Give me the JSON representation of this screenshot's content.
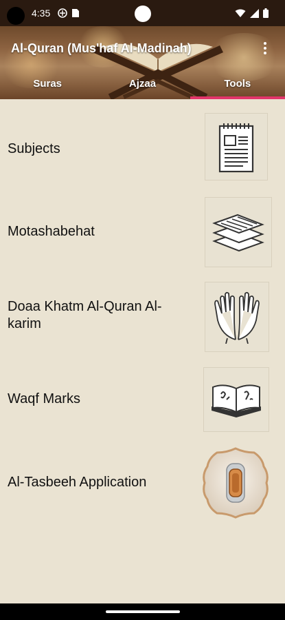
{
  "status_bar": {
    "time": "4:35",
    "icons_left": [
      "vpn-icon",
      "sim-card-icon"
    ],
    "icons_right": [
      "wifi-icon",
      "signal-icon",
      "battery-icon"
    ]
  },
  "header": {
    "title": "Al-Quran (Mus'haf Al-Madinah)",
    "tabs": [
      {
        "label": "Suras",
        "selected": false
      },
      {
        "label": "Ajzaa",
        "selected": false
      },
      {
        "label": "Tools",
        "selected": true
      }
    ],
    "accent_color": "#e2356a"
  },
  "tools": [
    {
      "label": "Subjects",
      "icon": "notepad-icon"
    },
    {
      "label": "Motashabehat",
      "icon": "layers-icon"
    },
    {
      "label": "Doaa Khatm Al-Quran Al-karim",
      "icon": "praying-hands-icon"
    },
    {
      "label": "Waqf Marks",
      "icon": "open-book-icon"
    },
    {
      "label": "Al-Tasbeeh Application",
      "icon": "tasbeeh-icon"
    }
  ]
}
